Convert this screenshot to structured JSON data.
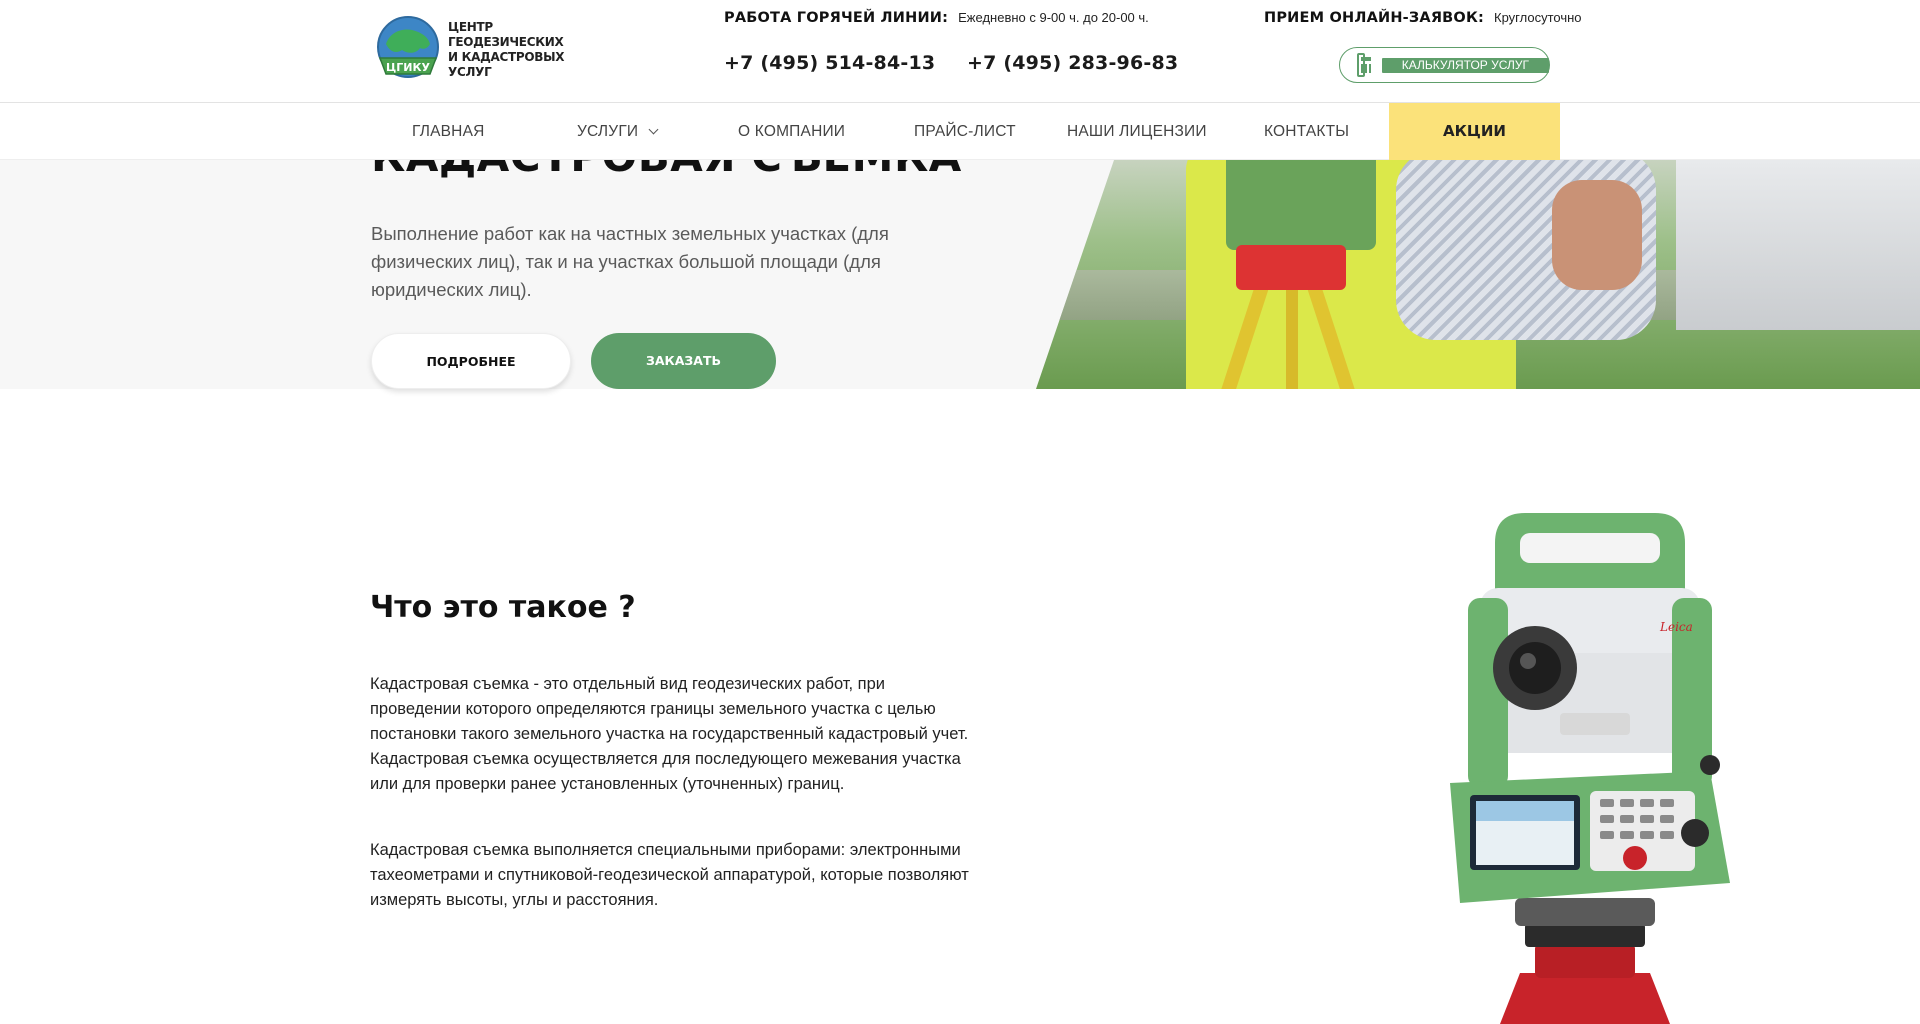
{
  "header": {
    "logo_line1": "ЦЕНТР ГЕОДЕЗИЧЕСКИХ",
    "logo_line2": "И КАДАСТРОВЫХ УСЛУГ",
    "logo_badge": "ЦГИКУ",
    "hotline_label": "РАБОТА ГОРЯЧЕЙ ЛИНИИ:",
    "hotline_hours": "Ежедневно с 9-00 ч. до 20-00 ч.",
    "phone1": "+7 (495) 514-84-13",
    "phone2": "+7 (495) 283-96-83",
    "online_label": "ПРИЕМ ОНЛАЙН-ЗАЯВОК:",
    "online_hours": "Круглосуточно",
    "calc_button": "КАЛЬКУЛЯТОР УСЛУГ"
  },
  "nav": {
    "items": [
      "ГЛАВНАЯ",
      "УСЛУГИ",
      "О КОМПАНИИ",
      "ПРАЙС-ЛИСТ",
      "НАШИ ЛИЦЕНЗИИ",
      "КОНТАКТЫ"
    ],
    "promo": "АКЦИИ"
  },
  "hero": {
    "title": "КАДАСТРОВАЯ СЪЕМКА",
    "description": "Выполнение работ как на частных земельных участках (для физических лиц), так и на участках большой площади (для юридических лиц).",
    "more_button": "ПОДРОБНЕЕ",
    "order_button": "ЗАКАЗАТЬ"
  },
  "info": {
    "heading": "Что это такое ?",
    "paragraph1": "Кадастровая съемка - это отдельный вид геодезических работ, при проведении которого определяются границы земельного участка с целью постановки такого земельного участка на государственный кадастровый учет. Кадастровая съемка осуществляется для последующего межевания участка или для проверки ранее установленных (уточненных) границ.",
    "paragraph2": "Кадастровая съемка выполняется специальными приборами: электронными тахеометрами и спутниковой-геодезической аппаратурой, которые позволяют измерять высоты, углы и расстояния.",
    "instrument_brand": "Leica"
  },
  "colors": {
    "accent_green": "#5e9e6a",
    "promo_yellow": "#fbe27a",
    "instrument_green": "#6db36f",
    "tripod_red": "#d1272b"
  }
}
